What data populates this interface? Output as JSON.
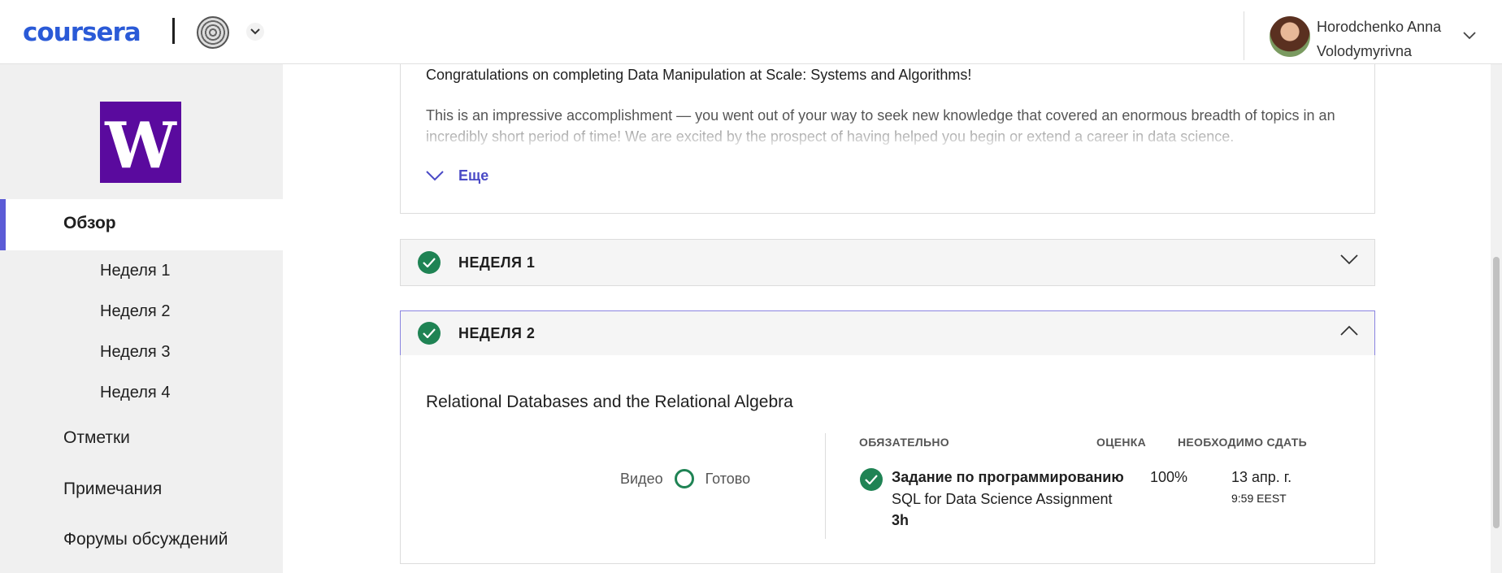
{
  "header": {
    "logo_text": "coursera",
    "user": {
      "name": "Horodchenko Anna Volodymyrivna"
    }
  },
  "sidebar": {
    "institution_logo_letter": "W",
    "active_item": "Обзор",
    "weeks": [
      "Неделя 1",
      "Неделя 2",
      "Неделя 3",
      "Неделя 4"
    ],
    "items": [
      "Отметки",
      "Примечания",
      "Форумы обсуждений"
    ]
  },
  "main": {
    "congrats": "Congratulations on completing Data Manipulation at Scale: Systems and Algorithms!",
    "description": "This is an impressive accomplishment — you went out of your way to seek new knowledge that covered an enormous breadth of topics in an incredibly short period of time! We are excited by the prospect of having helped you begin or extend a career in data science.",
    "more_label": "Еще",
    "weeks": [
      {
        "title": "НЕДЕЛЯ 1",
        "completed": true,
        "expanded": false
      },
      {
        "title": "НЕДЕЛЯ 2",
        "completed": true,
        "expanded": true
      }
    ],
    "week2": {
      "module_title": "Relational Databases and the Relational Algebra",
      "video_label": "Видео",
      "video_status": "Готово",
      "columns": {
        "required": "ОБЯЗАТЕЛЬНО",
        "grade": "ОЦЕНКА",
        "due": "НЕОБХОДИМО СДАТЬ"
      },
      "task": {
        "type": "Задание по программированию",
        "name": "SQL for Data Science Assignment",
        "duration": "3h",
        "grade": "100%",
        "due_date": "13 апр. г.",
        "due_time": "9:59 EEST"
      }
    }
  },
  "colors": {
    "accent": "#5b5bd6",
    "success": "#1f8354",
    "brand": "#2a5ad7",
    "uw_purple": "#5a0a9e"
  }
}
